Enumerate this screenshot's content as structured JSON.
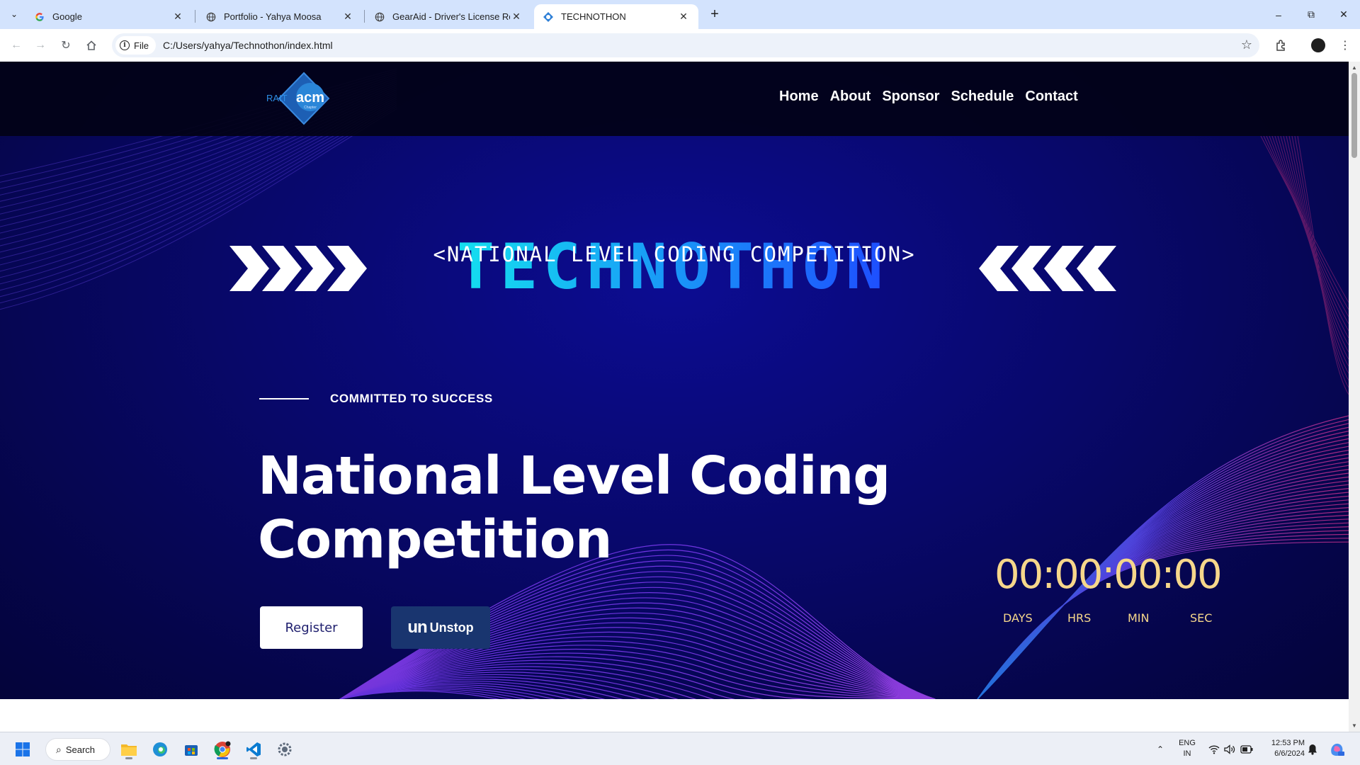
{
  "browser": {
    "tabs": [
      {
        "title": "Google",
        "icon": "google-g-icon",
        "active": false
      },
      {
        "title": "Portfolio - Yahya Moosa",
        "icon": "globe-icon",
        "active": false
      },
      {
        "title": "GearAid - Driver's License Regi",
        "icon": "globe-icon",
        "active": false
      },
      {
        "title": "TECHNOTHON",
        "icon": "acm-diamond-icon",
        "active": true
      }
    ],
    "site_chip_label": "File",
    "url": "C:/Users/yahya/Technothon/index.html"
  },
  "site": {
    "logo": {
      "left_text": "RAIT",
      "center_text": "acm",
      "sub_text": "Chapter"
    },
    "nav": [
      "Home",
      "About",
      "Sponsor",
      "Schedule",
      "Contact"
    ],
    "title": "TECHNOTHON",
    "subtitle": "<NATIONAL LEVEL CODING COMPETITION>",
    "tagline": "COMMITTED TO SUCCESS",
    "headline_line1": "National Level Coding",
    "headline_line2": "Competition",
    "register_label": "Register",
    "unstop_logo_text": "un",
    "unstop_label": "Unstop",
    "countdown": {
      "value": "00:00:00:00",
      "labels": [
        "DAYS",
        "HRS",
        "MIN",
        "SEC"
      ]
    },
    "colors": {
      "title_gradient_start": "#14e0ef",
      "title_gradient_end": "#1e4dff",
      "countdown": "#f6d78b",
      "nav_text": "#ffffff"
    }
  },
  "taskbar": {
    "search_label": "Search",
    "apps": [
      "windows-start-icon",
      "file-explorer-icon",
      "edge-icon",
      "store-icon",
      "chrome-icon",
      "vscode-icon",
      "settings-icon"
    ],
    "lang_line1": "ENG",
    "lang_line2": "IN",
    "time": "12:53 PM",
    "date": "6/6/2024"
  }
}
